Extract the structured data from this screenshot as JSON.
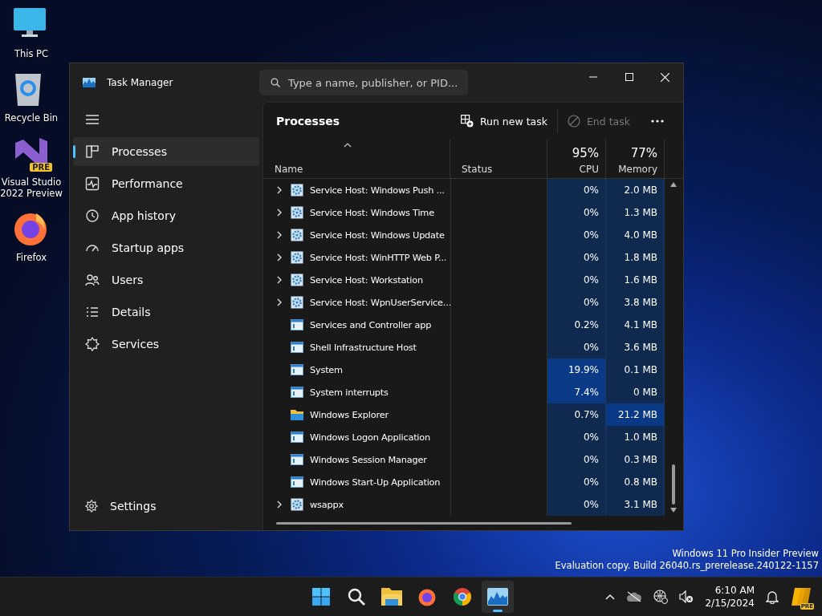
{
  "desktop_icons": [
    {
      "kind": "pc",
      "label": "This PC"
    },
    {
      "kind": "bin",
      "label": "Recycle Bin"
    },
    {
      "kind": "vs",
      "label": "Visual Studio 2022 Preview",
      "badge": "PRE"
    },
    {
      "kind": "firefox",
      "label": "Firefox"
    }
  ],
  "window": {
    "title": "Task Manager",
    "search": {
      "placeholder": "Type a name, publisher, or PID..."
    }
  },
  "nav": {
    "items": [
      {
        "kind": "processes",
        "label": "Processes",
        "selected": true
      },
      {
        "kind": "performance",
        "label": "Performance",
        "selected": false
      },
      {
        "kind": "history",
        "label": "App history",
        "selected": false
      },
      {
        "kind": "startup",
        "label": "Startup apps",
        "selected": false
      },
      {
        "kind": "users",
        "label": "Users",
        "selected": false
      },
      {
        "kind": "details",
        "label": "Details",
        "selected": false
      },
      {
        "kind": "services",
        "label": "Services",
        "selected": false
      }
    ],
    "settings": "Settings"
  },
  "toolbar": {
    "title": "Processes",
    "run_new_task": "Run new task",
    "end_task": {
      "label": "End task",
      "disabled": true
    }
  },
  "table": {
    "columns": {
      "name": "Name",
      "status": "Status",
      "cpu_total": "95%",
      "cpu": "CPU",
      "memory_total": "77%",
      "memory": "Memory"
    },
    "rows": [
      {
        "name": "Service Host: Windows Push ...",
        "kind": "service",
        "expandable": true,
        "cpu": "0%",
        "memory": "2.0 MB",
        "cpu_hot": false,
        "memory_hot": false
      },
      {
        "name": "Service Host: Windows Time",
        "kind": "service",
        "expandable": true,
        "cpu": "0%",
        "memory": "1.3 MB",
        "cpu_hot": false,
        "memory_hot": false
      },
      {
        "name": "Service Host: Windows Update",
        "kind": "service",
        "expandable": true,
        "cpu": "0%",
        "memory": "4.0 MB",
        "cpu_hot": false,
        "memory_hot": false
      },
      {
        "name": "Service Host: WinHTTP Web P...",
        "kind": "service",
        "expandable": true,
        "cpu": "0%",
        "memory": "1.8 MB",
        "cpu_hot": false,
        "memory_hot": false
      },
      {
        "name": "Service Host: Workstation",
        "kind": "service",
        "expandable": true,
        "cpu": "0%",
        "memory": "1.6 MB",
        "cpu_hot": false,
        "memory_hot": false
      },
      {
        "name": "Service Host: WpnUserService...",
        "kind": "service",
        "expandable": true,
        "cpu": "0%",
        "memory": "3.8 MB",
        "cpu_hot": false,
        "memory_hot": false
      },
      {
        "name": "Services and Controller app",
        "kind": "app",
        "expandable": false,
        "cpu": "0.2%",
        "memory": "4.1 MB",
        "cpu_hot": false,
        "memory_hot": false
      },
      {
        "name": "Shell Infrastructure Host",
        "kind": "app",
        "expandable": false,
        "cpu": "0%",
        "memory": "3.6 MB",
        "cpu_hot": false,
        "memory_hot": false
      },
      {
        "name": "System",
        "kind": "app",
        "expandable": false,
        "cpu": "19.9%",
        "memory": "0.1 MB",
        "cpu_hot": true,
        "memory_hot": false
      },
      {
        "name": "System interrupts",
        "kind": "app",
        "expandable": false,
        "cpu": "7.4%",
        "memory": "0 MB",
        "cpu_hot": true,
        "memory_hot": false
      },
      {
        "name": "Windows Explorer",
        "kind": "folder",
        "expandable": false,
        "cpu": "0.7%",
        "memory": "21.2 MB",
        "cpu_hot": false,
        "memory_hot": true
      },
      {
        "name": "Windows Logon Application",
        "kind": "app",
        "expandable": false,
        "cpu": "0%",
        "memory": "1.0 MB",
        "cpu_hot": false,
        "memory_hot": false
      },
      {
        "name": "Windows Session Manager",
        "kind": "app",
        "expandable": false,
        "cpu": "0%",
        "memory": "0.3 MB",
        "cpu_hot": false,
        "memory_hot": false
      },
      {
        "name": "Windows Start-Up Application",
        "kind": "app",
        "expandable": false,
        "cpu": "0%",
        "memory": "0.8 MB",
        "cpu_hot": false,
        "memory_hot": false
      },
      {
        "name": "wsappx",
        "kind": "service",
        "expandable": true,
        "cpu": "0%",
        "memory": "3.1 MB",
        "cpu_hot": false,
        "memory_hot": false
      }
    ]
  },
  "watermark": [
    "Windows 11 Pro Insider Preview",
    "Evaluation copy. Build 26040.rs_prerelease.240122-1157"
  ],
  "taskbar": {
    "apps": [
      {
        "kind": "start",
        "active": false
      },
      {
        "kind": "search",
        "active": false
      },
      {
        "kind": "explorer",
        "active": false
      },
      {
        "kind": "firefox",
        "active": false
      },
      {
        "kind": "chrome",
        "active": false
      },
      {
        "kind": "taskmgr",
        "active": true
      }
    ],
    "tray": {
      "time": "6:10 AM",
      "date": "2/15/2024",
      "copilot_badge": "PRE"
    }
  }
}
